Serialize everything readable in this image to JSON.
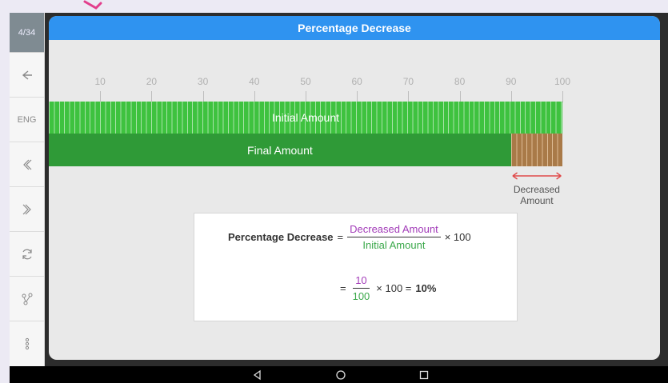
{
  "sidebar": {
    "page_indicator": "4/34",
    "items": [
      {
        "name": "back-icon",
        "label": ""
      },
      {
        "name": "language",
        "label": "ENG"
      },
      {
        "name": "previous-icon",
        "label": ""
      },
      {
        "name": "next-icon",
        "label": ""
      },
      {
        "name": "refresh-icon",
        "label": ""
      },
      {
        "name": "share-icon",
        "label": ""
      },
      {
        "name": "more-icon",
        "label": ""
      }
    ]
  },
  "title": "Percentage Decrease",
  "ruler": {
    "ticks": [
      "10",
      "20",
      "30",
      "40",
      "50",
      "60",
      "70",
      "80",
      "90",
      "100"
    ]
  },
  "bars": {
    "initial_label": "Initial Amount",
    "final_label": "Final Amount",
    "initial_value": 100,
    "final_value": 90,
    "decreased_label_line1": "Decreased",
    "decreased_label_line2": "Amount"
  },
  "formula": {
    "lhs": "Percentage Decrease",
    "equals": "=",
    "numerator": "Decreased Amount",
    "denominator": "Initial Amount",
    "times": "× 100",
    "num_value": "10",
    "den_value": "100",
    "times_equals": "× 100 =",
    "result": "10%"
  },
  "colors": {
    "title_bar": "#2f93f0",
    "initial_bar": "#3ec23f",
    "final_bar": "#2f9a37",
    "decrease_bar": "#a97a48",
    "arrow": "#e04a4a",
    "numerator": "#a23bb8",
    "denominator": "#3aa84a"
  }
}
